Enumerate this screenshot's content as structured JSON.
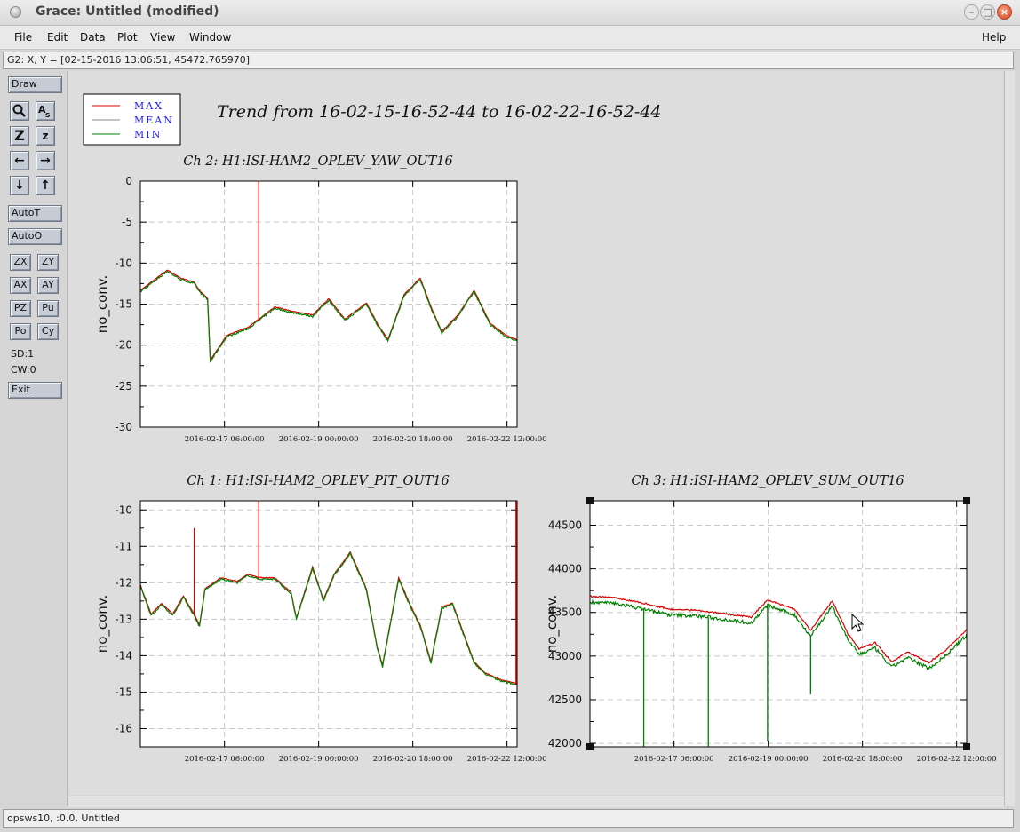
{
  "window": {
    "title": "Grace: Untitled (modified)",
    "min_glyph": "–",
    "max_glyph": "□",
    "close_glyph": "×"
  },
  "menu": {
    "file": "File",
    "edit": "Edit",
    "data": "Data",
    "plot": "Plot",
    "view": "View",
    "window": "Window",
    "help": "Help"
  },
  "locator": "G2: X, Y = [02-15-2016 13:06:51, 45472.765970]",
  "toolbar": {
    "draw": "Draw",
    "zoom_glyph": "Z",
    "zoom_small_glyph": "z",
    "left_glyph": "←",
    "right_glyph": "→",
    "down_glyph": "↓",
    "up_glyph": "↑",
    "autot": "AutoT",
    "autoo": "AutoO",
    "zx": "ZX",
    "zy": "ZY",
    "ax": "AX",
    "ay": "AY",
    "pz": "PZ",
    "pu": "Pu",
    "po": "Po",
    "cy": "Cy",
    "sd": "SD:1",
    "cw": "CW:0",
    "exit": "Exit"
  },
  "status": "opsws10, :0.0, Untitled",
  "colors": {
    "max": "#dd0000",
    "mean": "#888888",
    "min": "#008000",
    "legend_text": "#1a1aff"
  },
  "chart_data": {
    "title": "Trend from 16-02-15-16-52-44 to 16-02-22-16-52-44",
    "legend": [
      {
        "name": "MAX"
      },
      {
        "name": "MEAN"
      },
      {
        "name": "MIN"
      }
    ],
    "x_ticks": [
      "2016-02-17 06:00:00",
      "2016-02-19 00:00:00",
      "2016-02-20 18:00:00",
      "2016-02-22 12:00:00"
    ],
    "panels": [
      {
        "id": "ch2",
        "type": "line",
        "title": "Ch 2: H1:ISI-HAM2_OPLEV_YAW_OUT16",
        "ylabel": "no_conv.",
        "ylim": [
          -30,
          0
        ],
        "y_ticks": [
          "0",
          "-5",
          "-10",
          "-15",
          "-20",
          "-25",
          "-30"
        ],
        "x_days": [
          0,
          0.3,
          0.5,
          0.75,
          1.0,
          1.1,
          1.25,
          1.3,
          1.6,
          2.0,
          2.2,
          2.5,
          2.8,
          3.2,
          3.5,
          3.8,
          4.2,
          4.4,
          4.6,
          4.9,
          5.2,
          5.4,
          5.6,
          5.9,
          6.2,
          6.5,
          6.8,
          7.0
        ],
        "series": [
          {
            "name": "MIN",
            "values": [
              -13.5,
              -12.0,
              -11.0,
              -12.0,
              -12.5,
              -13.5,
              -14.5,
              -22.0,
              -19.0,
              -18.0,
              -17.0,
              -15.5,
              -16.0,
              -16.5,
              -14.5,
              -17.0,
              -15.0,
              -17.5,
              -19.5,
              -14.0,
              -12.0,
              -15.5,
              -18.5,
              -16.5,
              -13.5,
              -17.5,
              -19.0,
              -19.5
            ]
          },
          {
            "name": "MAX",
            "spikes": [
              {
                "x_day": 2.2,
                "value": 0
              }
            ]
          }
        ]
      },
      {
        "id": "ch1",
        "type": "line",
        "title": "Ch 1: H1:ISI-HAM2_OPLEV_PIT_OUT16",
        "ylabel": "no_conv.",
        "ylim": [
          -16.5,
          -9.75
        ],
        "y_ticks": [
          "-10",
          "-11",
          "-12",
          "-13",
          "-14",
          "-15",
          "-16"
        ],
        "x_days": [
          0,
          0.2,
          0.4,
          0.6,
          0.8,
          1.0,
          1.1,
          1.2,
          1.5,
          1.8,
          2.0,
          2.2,
          2.5,
          2.8,
          2.9,
          3.2,
          3.4,
          3.6,
          3.9,
          4.2,
          4.4,
          4.5,
          4.8,
          5.0,
          5.2,
          5.4,
          5.6,
          5.8,
          6.0,
          6.2,
          6.4,
          6.7,
          7.0
        ],
        "series": [
          {
            "name": "MIN",
            "values": [
              -12.1,
              -12.9,
              -12.6,
              -12.9,
              -12.4,
              -12.9,
              -13.2,
              -12.2,
              -11.9,
              -12.0,
              -11.8,
              -11.9,
              -11.9,
              -12.3,
              -13.0,
              -11.6,
              -12.5,
              -11.8,
              -11.2,
              -12.2,
              -13.8,
              -14.3,
              -11.9,
              -12.6,
              -13.2,
              -14.2,
              -12.7,
              -12.6,
              -13.4,
              -14.2,
              -14.5,
              -14.7,
              -14.8
            ]
          },
          {
            "name": "MAX",
            "spikes": [
              {
                "x_day": 1.0,
                "value": -10.5
              },
              {
                "x_day": 2.2,
                "value": -9.75
              },
              {
                "x_day": 6.98,
                "value": -9.75
              }
            ]
          }
        ]
      },
      {
        "id": "ch3",
        "type": "line",
        "title": "Ch 3: H1:ISI-HAM2_OPLEV_SUM_OUT16",
        "ylabel": "no_conv.",
        "ylim": [
          41960,
          44780
        ],
        "y_ticks": [
          "44500",
          "44000",
          "43500",
          "43000",
          "42500",
          "42000"
        ],
        "x_days": [
          0,
          0.5,
          1.0,
          1.5,
          2.0,
          2.5,
          3.0,
          3.3,
          3.8,
          4.1,
          4.5,
          4.8,
          5.0,
          5.3,
          5.6,
          5.9,
          6.3,
          6.6,
          7.0
        ],
        "series": [
          {
            "name": "MIN",
            "values": [
              43620,
              43600,
              43540,
              43470,
              43460,
              43420,
              43380,
              43580,
              43470,
              43230,
              43570,
              43180,
              43020,
              43090,
              42870,
              42980,
              42860,
              43000,
              43240
            ]
          },
          {
            "name": "MIN",
            "drops": [
              {
                "x_day": 1.0,
                "value": 41960
              },
              {
                "x_day": 2.2,
                "value": 41960
              },
              {
                "x_day": 3.3,
                "value": 42020
              },
              {
                "x_day": 4.1,
                "value": 42560
              }
            ]
          }
        ]
      }
    ]
  }
}
